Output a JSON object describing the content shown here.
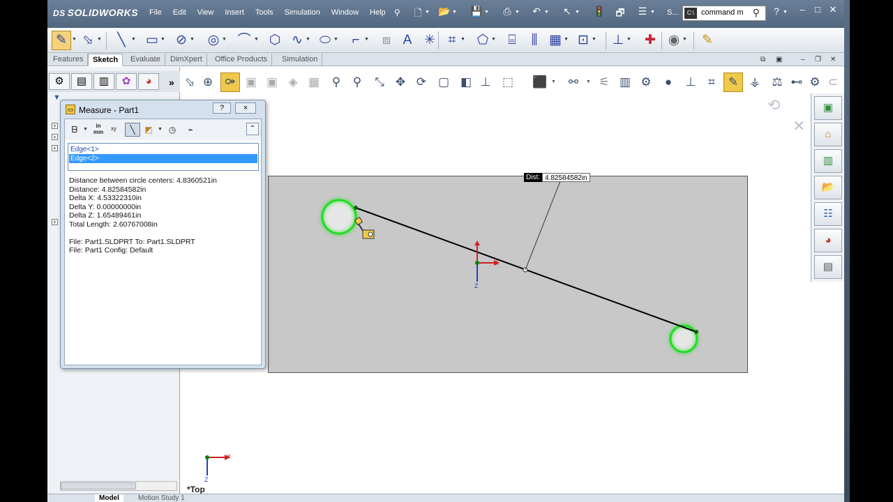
{
  "app": {
    "logo": "SOLIDWORKS",
    "logo_ds": "DS"
  },
  "menu": [
    "File",
    "Edit",
    "View",
    "Insert",
    "Tools",
    "Simulation",
    "Window",
    "Help"
  ],
  "titlebar": {
    "doc_label": "S...",
    "search_placeholder": "command m"
  },
  "tabs": [
    "Features",
    "Sketch",
    "Evaluate",
    "DimXpert",
    "Office Products",
    "Simulation"
  ],
  "active_tab": "Sketch",
  "measure_dialog": {
    "title": "Measure - Part1",
    "help": "?",
    "close": "×",
    "units_label": "in mm",
    "selections": [
      "Edge<1>",
      "Edge<2>"
    ],
    "results": [
      "Distance between circle centers:  4.8360521in",
      "Distance: 4.82584582in",
      "Delta X: 4.53322310in",
      "Delta Y: 0.00000000in",
      "Delta Z: 1.65489461in",
      "Total Length: 2.60767008in"
    ],
    "file_info": [
      "File: Part1.SLDPRT To: Part1.SLDPRT",
      "File: Part1 Config: Default"
    ]
  },
  "viewport": {
    "dist_label": "Dist:",
    "dist_value": "4.82584582in",
    "view_name": "*Top",
    "axis_x": "X",
    "axis_z": "Z"
  },
  "bottom_tabs": [
    "Model",
    "Motion Study 1"
  ],
  "colors": {
    "selected_edge": "#22dd22",
    "sketch_plate": "#c8c8c8",
    "selection_highlight": "#3399ff"
  }
}
